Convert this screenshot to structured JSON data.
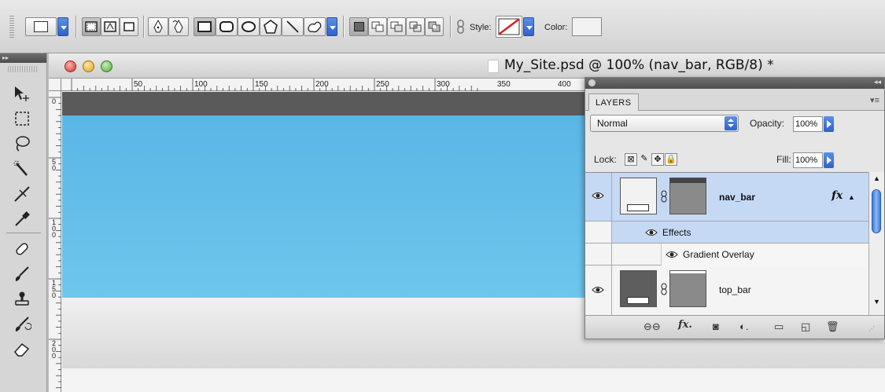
{
  "options_bar": {
    "tool_preset_icon": "rectangle-preset-icon",
    "mode_icons": [
      "shape-layers-icon",
      "paths-icon",
      "fill-pixels-icon"
    ],
    "pen_icons": [
      "pen-icon",
      "freeform-pen-icon"
    ],
    "shape_icons": [
      "rectangle-icon",
      "rounded-rectangle-icon",
      "ellipse-icon",
      "polygon-icon",
      "line-icon",
      "custom-shape-icon"
    ],
    "combine_icons": [
      "create-new-shape-icon",
      "add-to-area-icon",
      "subtract-icon",
      "intersect-icon",
      "exclude-icon"
    ],
    "style_label": "Style:",
    "color_label": "Color:",
    "color_swatch": "#f2f2f2"
  },
  "tools_panel": {
    "header": "▸▸",
    "tools": [
      "move-tool-icon",
      "marquee-tool-icon",
      "lasso-tool-icon",
      "quick-selection-tool-icon",
      "crop-tool-icon",
      "eyedropper-tool-icon",
      "healing-brush-tool-icon",
      "brush-tool-icon",
      "clone-stamp-tool-icon",
      "history-brush-tool-icon",
      "eraser-tool-icon"
    ]
  },
  "document": {
    "title": "My_Site.psd @ 100% (nav_bar, RGB/8) *",
    "ruler_h_labels": [
      "50",
      "100",
      "150",
      "200",
      "250",
      "300",
      "350",
      "400"
    ],
    "ruler_v_labels": [
      "0",
      "5\n0",
      "1\n0\n0",
      "1\n5\n0",
      "2\n0\n0"
    ],
    "canvas_colors": {
      "top_bar": "#5a5a5a",
      "nav_bar_top": "#5ab6e6",
      "nav_bar_bottom": "#6dc6ec",
      "footer": "#e4e4e4"
    }
  },
  "layers_panel": {
    "tab_label": "LAYERS",
    "blend_mode": "Normal",
    "opacity_label": "Opacity:",
    "opacity_value": "100%",
    "lock_label": "Lock:",
    "fill_label": "Fill:",
    "fill_value": "100%",
    "layers": [
      {
        "name": "nav_bar",
        "fx": "fx",
        "selected": true
      },
      {
        "name": "top_bar",
        "fx": "",
        "selected": false
      }
    ],
    "effects_label": "Effects",
    "effect_item": "Gradient Overlay",
    "footer_fx": "fx."
  }
}
